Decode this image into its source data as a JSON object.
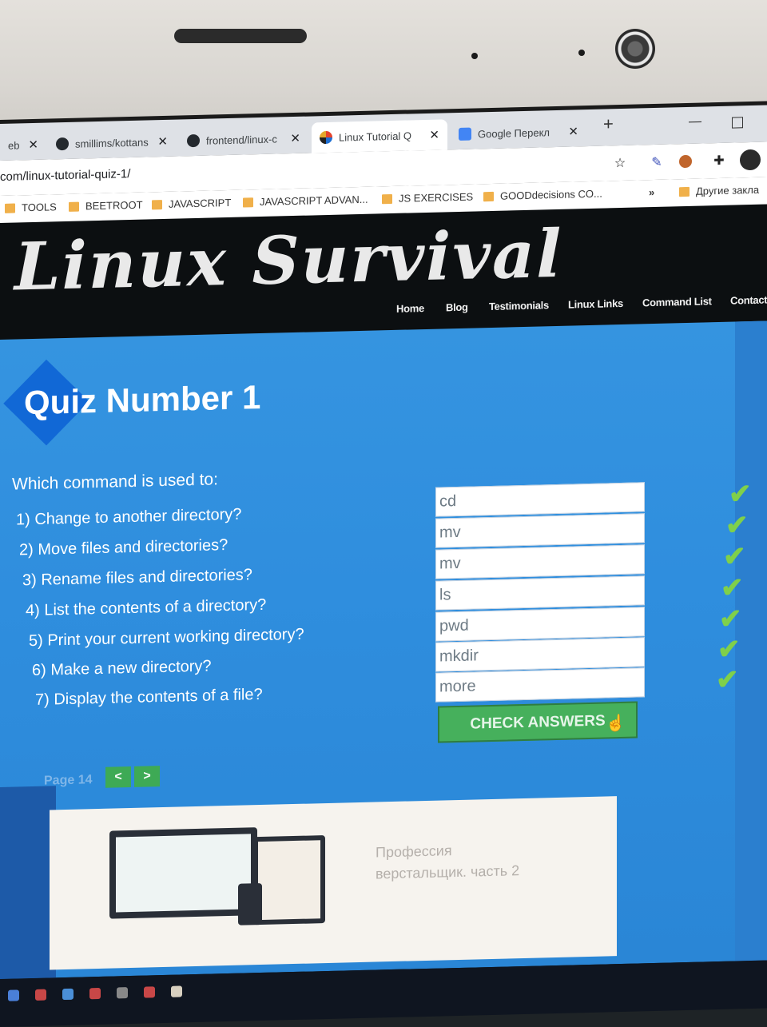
{
  "browser": {
    "tabs": [
      {
        "label": "eb",
        "close": "✕"
      },
      {
        "label": "smillims/kottans",
        "close": "✕",
        "icon": "github-icon"
      },
      {
        "label": "frontend/linux-c",
        "close": "✕",
        "icon": "github-icon"
      },
      {
        "label": "Linux Tutorial Q",
        "close": "✕",
        "icon": "linux-survival-icon",
        "active": true
      },
      {
        "label": "Google Перекл",
        "close": "✕",
        "icon": "google-translate-icon"
      }
    ],
    "new_tab": "+",
    "url": "com/linux-tutorial-quiz-1/",
    "bookmarks": [
      "TOOLS",
      "BEETROOT",
      "JAVASCRIPT",
      "JAVASCRIPT ADVAN...",
      "JS EXERCISES",
      "GOODdecisions CO..."
    ],
    "bookmarks_overflow": "»",
    "other_bookmarks": "Другие закла",
    "accent": "#f0b04a"
  },
  "site": {
    "logo": "Linux Survival",
    "nav": [
      "Home",
      "Blog",
      "Testimonials",
      "Linux Links",
      "Command List",
      "Contact"
    ]
  },
  "quiz": {
    "title": "Quiz Number 1",
    "lead": "Which command is used to:",
    "questions": [
      {
        "text": "1) Change to another directory?",
        "answer": "cd",
        "correct": true
      },
      {
        "text": "2) Move files and directories?",
        "answer": "mv",
        "correct": true
      },
      {
        "text": "3) Rename files and directories?",
        "answer": "mv",
        "correct": true
      },
      {
        "text": "4) List the contents of a directory?",
        "answer": "ls",
        "correct": true
      },
      {
        "text": "5) Print your current working directory?",
        "answer": "pwd",
        "correct": true
      },
      {
        "text": "6) Make a new directory?",
        "answer": "mkdir",
        "correct": true
      },
      {
        "text": "7) Display the contents of a file?",
        "answer": "more",
        "correct": true
      }
    ],
    "check_mark": "✔",
    "check_button": "CHECK ANSWERS",
    "page_label": "Page 14",
    "prev": "<",
    "next": ">",
    "button_color": "#46b05c",
    "check_color": "#7fd04b"
  },
  "ad": {
    "line1": "Профессия",
    "line2": "верстальщик. часть 2"
  }
}
